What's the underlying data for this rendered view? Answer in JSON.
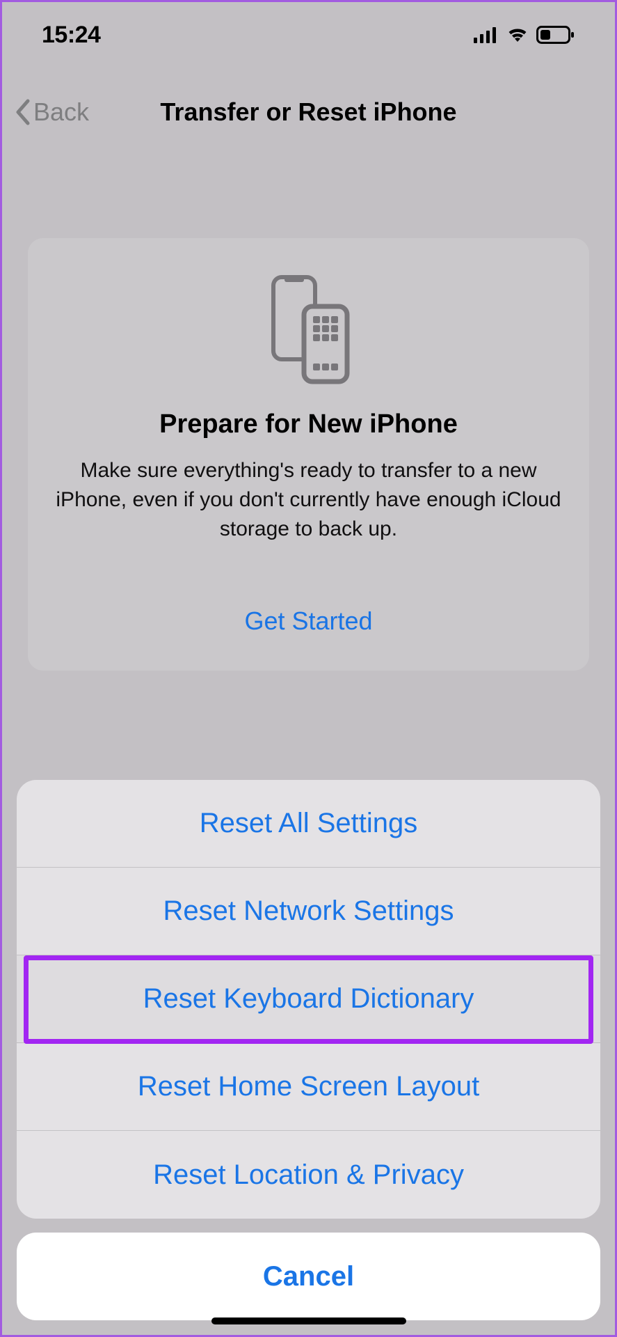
{
  "status_bar": {
    "time": "15:24"
  },
  "nav": {
    "back_label": "Back",
    "title": "Transfer or Reset iPhone"
  },
  "card": {
    "title": "Prepare for New iPhone",
    "description": "Make sure everything's ready to transfer to a new iPhone, even if you don't currently have enough iCloud storage to back up.",
    "action": "Get Started"
  },
  "action_sheet": {
    "items": [
      "Reset All Settings",
      "Reset Network Settings",
      "Reset Keyboard Dictionary",
      "Reset Home Screen Layout",
      "Reset Location & Privacy"
    ],
    "highlighted_index": 2,
    "cancel": "Cancel"
  }
}
